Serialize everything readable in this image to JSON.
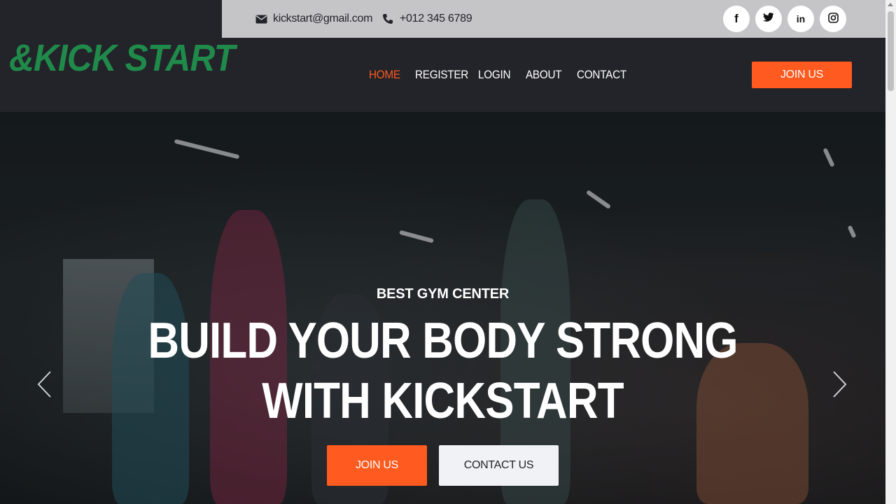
{
  "topbar": {
    "email": "kickstart@gmail.com",
    "phone": "+012 345 6789",
    "social": [
      {
        "icon": "facebook-icon",
        "glyph": "f"
      },
      {
        "icon": "twitter-icon",
        "glyph": "🐦"
      },
      {
        "icon": "linkedin-icon",
        "glyph": "in"
      },
      {
        "icon": "instagram-icon",
        "glyph": "◎"
      }
    ]
  },
  "header": {
    "logo": "&KICK START",
    "nav": [
      "HOME",
      "REGISTER",
      "LOGIN",
      "ABOUT",
      "CONTACT"
    ],
    "active_nav": "HOME",
    "join_button": "JOIN US"
  },
  "hero": {
    "subtitle": "BEST GYM CENTER",
    "headline_line1": "BUILD YOUR BODY STRONG",
    "headline_line2": "WITH KICKSTART",
    "primary_button": "JOIN US",
    "secondary_button": "CONTACT US",
    "prev_arrow": "‹",
    "next_arrow": "›"
  },
  "colors": {
    "accent": "#ff5a1f",
    "logo": "#1f8a4a",
    "dark": "#23232a",
    "topbar": "#c5c5c8"
  }
}
